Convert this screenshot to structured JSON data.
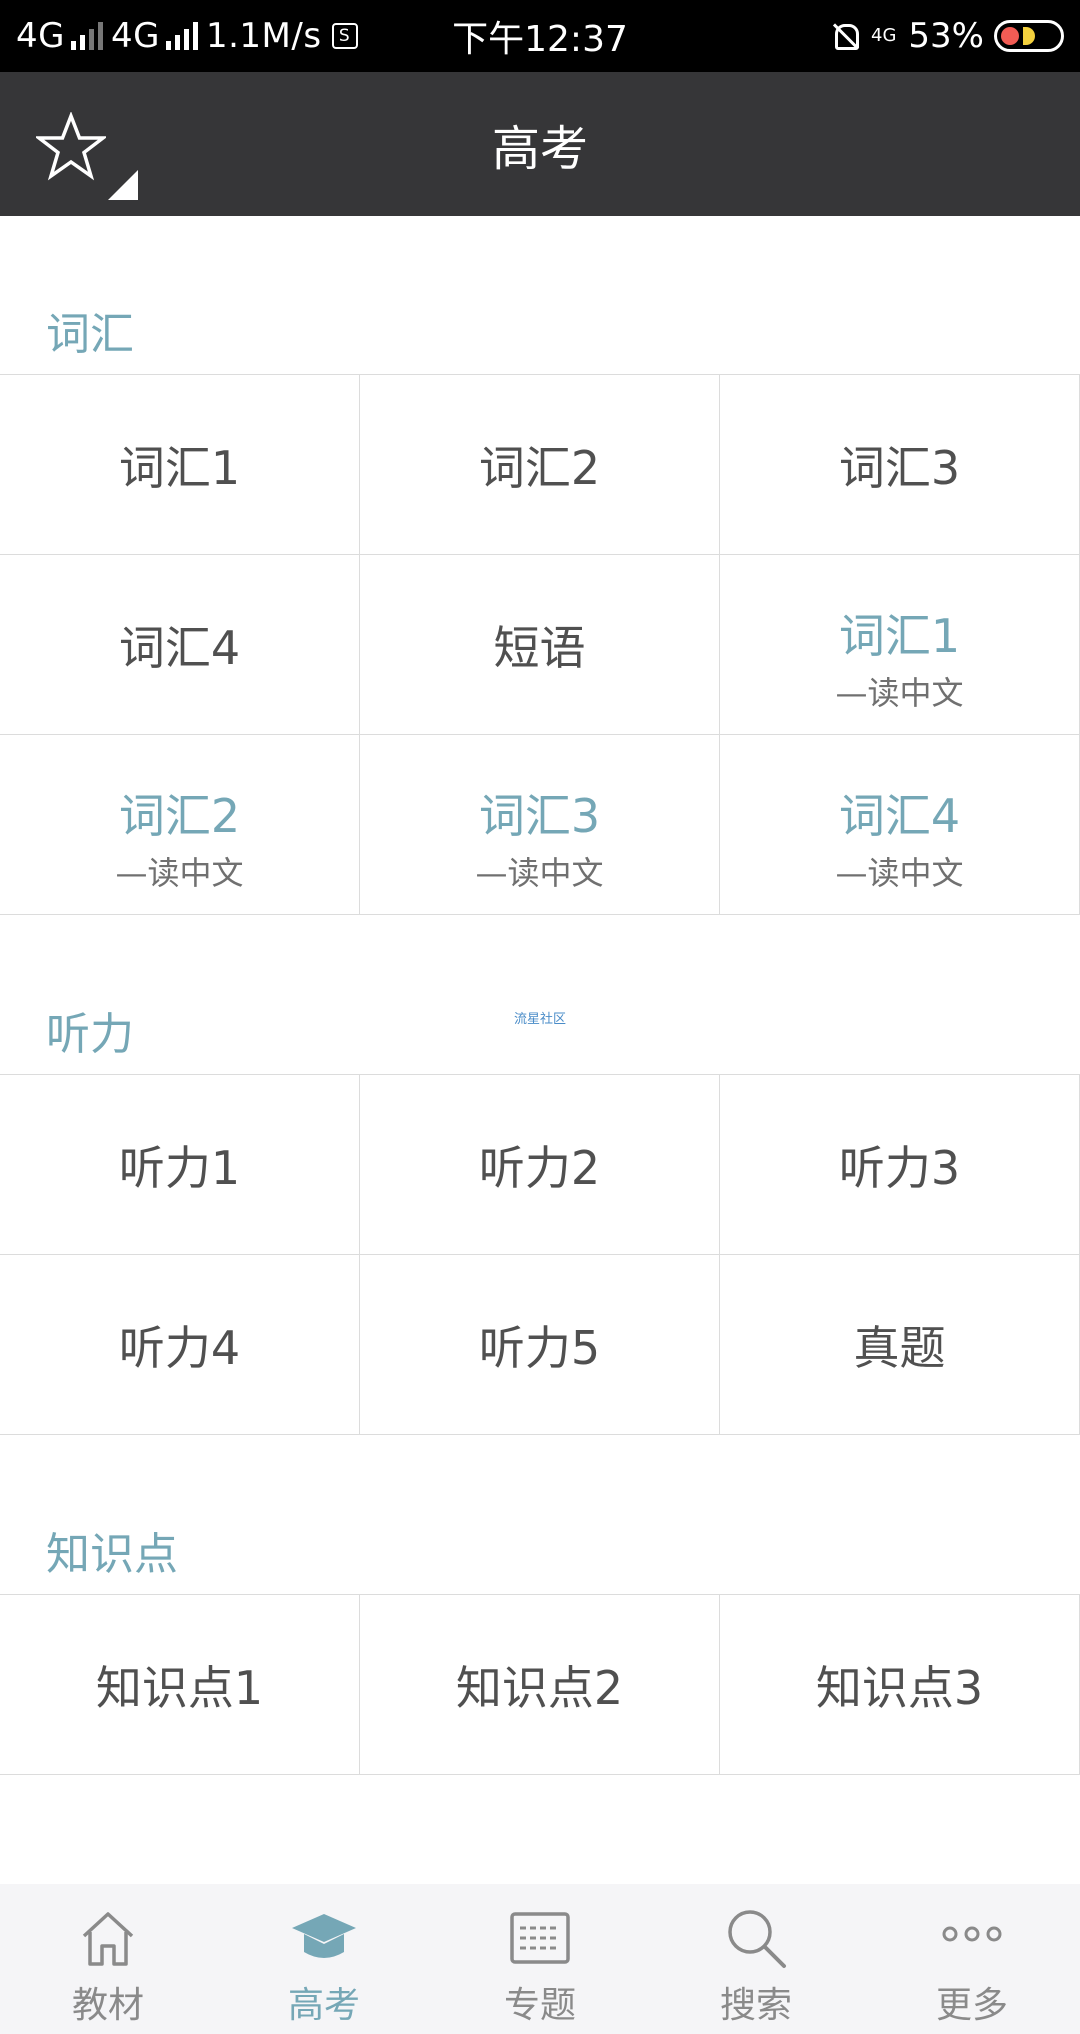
{
  "status_bar": {
    "net1": "4G",
    "net2": "4G",
    "speed": "1.1M/s",
    "box": "S",
    "time": "下午12:37",
    "lte": "4G",
    "battery": "53%"
  },
  "header": {
    "title": "高考",
    "icon": "star-icon"
  },
  "sections": {
    "vocab": {
      "title": "词汇",
      "items": [
        {
          "main": "词汇1",
          "sub": ""
        },
        {
          "main": "词汇2",
          "sub": ""
        },
        {
          "main": "词汇3",
          "sub": ""
        },
        {
          "main": "词汇4",
          "sub": ""
        },
        {
          "main": "短语",
          "sub": ""
        },
        {
          "main": "词汇1",
          "sub": "—读中文"
        },
        {
          "main": "词汇2",
          "sub": "—读中文"
        },
        {
          "main": "词汇3",
          "sub": "—读中文"
        },
        {
          "main": "词汇4",
          "sub": "—读中文"
        }
      ]
    },
    "listening": {
      "title": "听力",
      "items": [
        {
          "main": "听力1"
        },
        {
          "main": "听力2"
        },
        {
          "main": "听力3"
        },
        {
          "main": "听力4"
        },
        {
          "main": "听力5"
        },
        {
          "main": "真题"
        }
      ]
    },
    "knowledge": {
      "title": "知识点",
      "items": [
        {
          "main": "知识点1"
        },
        {
          "main": "知识点2"
        },
        {
          "main": "知识点3"
        }
      ]
    }
  },
  "watermark": "流星社区",
  "bottom_nav": [
    {
      "label": "教材",
      "icon": "home-icon",
      "active": false
    },
    {
      "label": "高考",
      "icon": "graduation-cap-icon",
      "active": true
    },
    {
      "label": "专题",
      "icon": "topics-icon",
      "active": false
    },
    {
      "label": "搜索",
      "icon": "search-icon",
      "active": false
    },
    {
      "label": "更多",
      "icon": "more-icon",
      "active": false
    }
  ],
  "colors": {
    "accent": "#75a7b6",
    "header_bg": "#363638",
    "status_bg": "#000000",
    "nav_bg": "#f5f5f7"
  }
}
